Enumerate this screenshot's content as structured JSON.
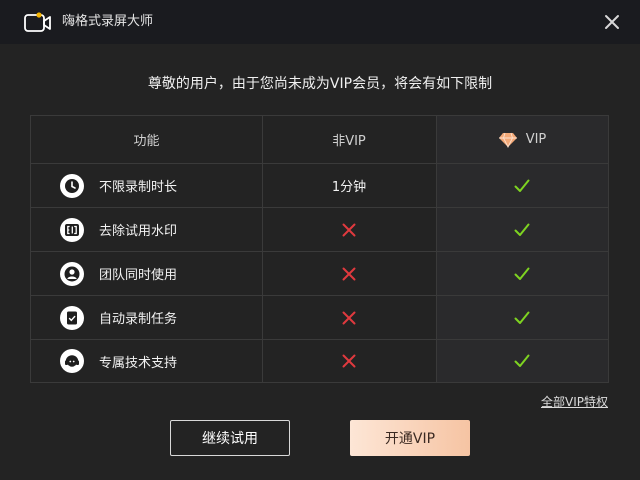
{
  "window": {
    "title": "嗨格式录屏大师"
  },
  "icons": {
    "app": "video-camera-icon",
    "close": "close-icon",
    "vip": "diamond-icon",
    "check": "check-icon",
    "cross": "cross-icon"
  },
  "headline": "尊敬的用户，由于您尚未成为VIP会员，将会有如下限制",
  "table": {
    "headers": {
      "feature": "功能",
      "non_vip": "非VIP",
      "vip": "VIP"
    },
    "rows": [
      {
        "label": "不限录制时长",
        "icon": "clock-icon",
        "non_vip": "1分钟",
        "non_vip_allowed": true,
        "vip_allowed": true
      },
      {
        "label": "去除试用水印",
        "icon": "watermark-icon",
        "non_vip": "",
        "non_vip_allowed": false,
        "vip_allowed": true
      },
      {
        "label": "团队同时使用",
        "icon": "user-icon",
        "non_vip": "",
        "non_vip_allowed": false,
        "vip_allowed": true
      },
      {
        "label": "自动录制任务",
        "icon": "task-icon",
        "non_vip": "",
        "non_vip_allowed": false,
        "vip_allowed": true
      },
      {
        "label": "专属技术支持",
        "icon": "support-headset-icon",
        "non_vip": "",
        "non_vip_allowed": false,
        "vip_allowed": true
      }
    ]
  },
  "links": {
    "all_vip": "全部VIP特权"
  },
  "buttons": {
    "trial": "继续试用",
    "open_vip": "开通VIP"
  },
  "colors": {
    "check": "#7ed321",
    "cross": "#e0393e",
    "cta_start": "#fde6d6",
    "cta_end": "#f6c4a3",
    "background": "#232323",
    "titlebar": "#1a1b1f"
  }
}
